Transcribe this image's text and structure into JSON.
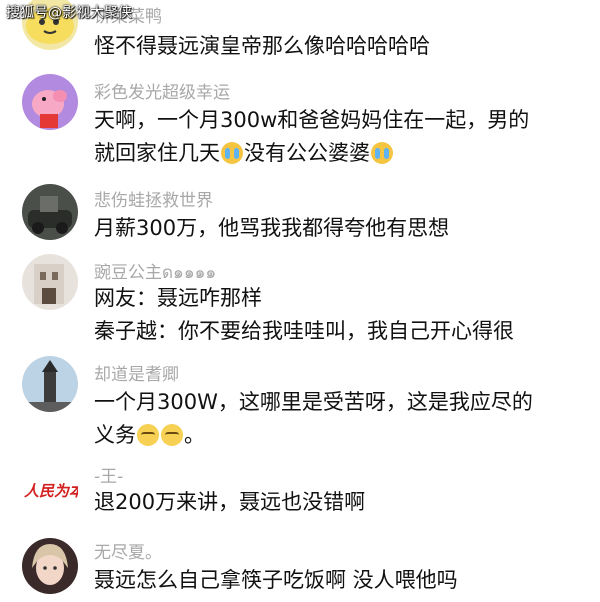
{
  "watermark": "搜狐号@影视大聚侠",
  "comments": [
    {
      "name": "饼菜菜鸭",
      "lines": [
        "怪不得聂远演皇帝那么像哈哈哈哈哈"
      ],
      "avatar": "yellow-cartoon-avatar"
    },
    {
      "name": "彩色发光超级幸运",
      "lines": [
        "天啊，一个月300w和爸爸妈妈住在一起，男的",
        "就回家住几天",
        "没有公公婆婆"
      ],
      "avatar": "peppa-pig-avatar"
    },
    {
      "name": "悲伤蛙拯救世界",
      "lines": [
        "月薪300万，他骂我我都得夸他有思想"
      ],
      "avatar": "dark-photo-avatar"
    },
    {
      "name": "豌豆公主ด๑๑๑๑",
      "lines": [
        "网友：聂远咋那样",
        "秦子越：你不要给我哇哇叫，我自己开心得很"
      ],
      "avatar": "building-photo-avatar"
    },
    {
      "name": "却道是耆卿",
      "lines": [
        "一个月300W，这哪里是受苦呀，这是我应尽的",
        "义务",
        "。"
      ],
      "avatar": "tower-photo-avatar"
    },
    {
      "name": "-王-",
      "lines": [
        "退200万来讲，聂远也没错啊"
      ],
      "avatar": "calligraphy-logo-avatar",
      "logo_text": "人民为本"
    },
    {
      "name": "无尽夏。",
      "lines": [
        "聂远怎么自己拿筷子吃饭啊 没人喂他吗"
      ],
      "avatar": "girl-portrait-avatar"
    }
  ],
  "colors": {
    "name": "#a8a8a8",
    "text": "#111111"
  }
}
